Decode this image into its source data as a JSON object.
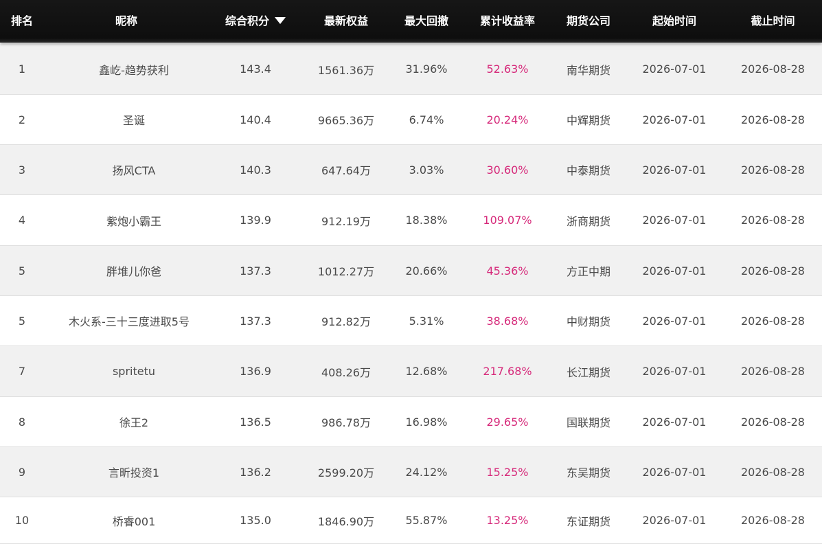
{
  "columns": {
    "rank": "排名",
    "nickname": "昵称",
    "score": "综合积分",
    "equity": "最新权益",
    "drawdown": "最大回撤",
    "yield": "累计收益率",
    "company": "期货公司",
    "start": "起始时间",
    "end": "截止时间"
  },
  "sort_icon": "triangle-down-icon",
  "colors": {
    "header_bg": "#111111",
    "yield_text": "#d6297a",
    "row_alt": "#f1f1f1"
  },
  "rows": [
    {
      "rank": "1",
      "nickname": "鑫屹-趋势获利",
      "score": "143.4",
      "equity": "1561.36万",
      "drawdown": "31.96%",
      "yield": "52.63%",
      "company": "南华期货",
      "start": "2026-07-01",
      "end": "2026-08-28"
    },
    {
      "rank": "2",
      "nickname": "圣诞",
      "score": "140.4",
      "equity": "9665.36万",
      "drawdown": "6.74%",
      "yield": "20.24%",
      "company": "中辉期货",
      "start": "2026-07-01",
      "end": "2026-08-28"
    },
    {
      "rank": "3",
      "nickname": "扬风CTA",
      "score": "140.3",
      "equity": "647.64万",
      "drawdown": "3.03%",
      "yield": "30.60%",
      "company": "中泰期货",
      "start": "2026-07-01",
      "end": "2026-08-28"
    },
    {
      "rank": "4",
      "nickname": "紫炮小霸王",
      "score": "139.9",
      "equity": "912.19万",
      "drawdown": "18.38%",
      "yield": "109.07%",
      "company": "浙商期货",
      "start": "2026-07-01",
      "end": "2026-08-28"
    },
    {
      "rank": "5",
      "nickname": "胖堆儿你爸",
      "score": "137.3",
      "equity": "1012.27万",
      "drawdown": "20.66%",
      "yield": "45.36%",
      "company": "方正中期",
      "start": "2026-07-01",
      "end": "2026-08-28"
    },
    {
      "rank": "5",
      "nickname": "木火系-三十三度进取5号",
      "score": "137.3",
      "equity": "912.82万",
      "drawdown": "5.31%",
      "yield": "38.68%",
      "company": "中财期货",
      "start": "2026-07-01",
      "end": "2026-08-28"
    },
    {
      "rank": "7",
      "nickname": "spritetu",
      "score": "136.9",
      "equity": "408.26万",
      "drawdown": "12.68%",
      "yield": "217.68%",
      "company": "长江期货",
      "start": "2026-07-01",
      "end": "2026-08-28"
    },
    {
      "rank": "8",
      "nickname": "徐王2",
      "score": "136.5",
      "equity": "986.78万",
      "drawdown": "16.98%",
      "yield": "29.65%",
      "company": "国联期货",
      "start": "2026-07-01",
      "end": "2026-08-28"
    },
    {
      "rank": "9",
      "nickname": "言昕投资1",
      "score": "136.2",
      "equity": "2599.20万",
      "drawdown": "24.12%",
      "yield": "15.25%",
      "company": "东吴期货",
      "start": "2026-07-01",
      "end": "2026-08-28"
    },
    {
      "rank": "10",
      "nickname": "桥睿001",
      "score": "135.0",
      "equity": "1846.90万",
      "drawdown": "55.87%",
      "yield": "13.25%",
      "company": "东证期货",
      "start": "2026-07-01",
      "end": "2026-08-28"
    }
  ]
}
